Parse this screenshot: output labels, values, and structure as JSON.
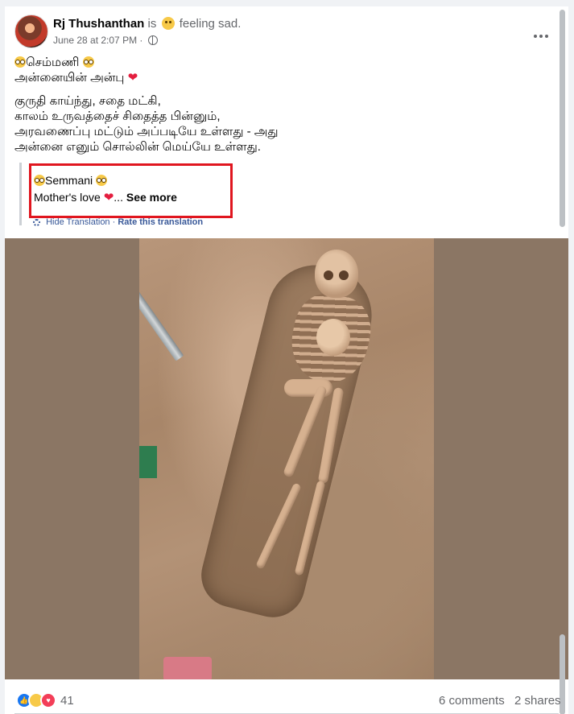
{
  "post": {
    "author": "Rj Thushanthan",
    "is_text": "is",
    "feeling": "feeling sad.",
    "timestamp": "June 28 at 2:07 PM",
    "privacy_separator": "·",
    "privacy_icon": "globe-icon",
    "lines": {
      "title": "செம்மணி",
      "subtitle": "அன்னையின் அன்பு",
      "verse1": "குருதி காய்ந்து, சதை மட்கி,",
      "verse2": "காலம் உருவத்தைச் சிதைத்த பின்னும்,",
      "verse3": "அரவணைப்பு மட்டும் அப்படியே உள்ளது - அது",
      "verse4": "அன்னை எனும் சொல்லின் மெய்யே உள்ளது."
    }
  },
  "translation": {
    "line1": "Semmani",
    "line2": "Mother's love",
    "ellipsis": "...",
    "see_more": "See more",
    "hide": "Hide Translation",
    "separator": "·",
    "rate": "Rate this translation"
  },
  "footer": {
    "reaction_count": "41",
    "comments": "6 comments",
    "shares": "2 shares"
  },
  "colors": {
    "highlight": "#e0161f",
    "link": "#385898",
    "like": "#1877f2",
    "love": "#f33e58"
  }
}
